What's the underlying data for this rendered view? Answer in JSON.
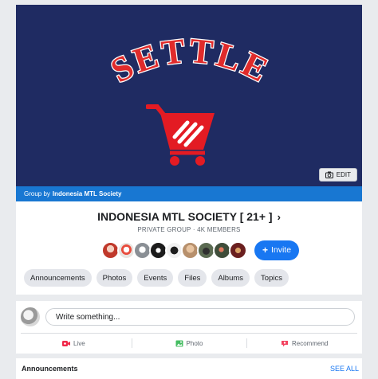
{
  "cover": {
    "title": "SETTLE",
    "edit_label": "EDIT",
    "colors": {
      "background": "#1f2b62",
      "title_fill": "#e02b2b",
      "cart": "#e31b23"
    }
  },
  "group_by": {
    "prefix": "Group by",
    "name": "Indonesia MTL Society"
  },
  "group": {
    "name": "INDONESIA MTL SOCIETY [ 21+ ]",
    "meta": "PRIVATE GROUP · 4K MEMBERS",
    "invite_label": "Invite"
  },
  "members": [
    {
      "icon": "member-avatar",
      "color": "#c0392b"
    },
    {
      "icon": "member-avatar",
      "color": "#e8e4e0"
    },
    {
      "icon": "member-avatar",
      "color": "#8a8f95"
    },
    {
      "icon": "member-avatar",
      "color": "#1c1c1c"
    },
    {
      "icon": "member-avatar",
      "color": "#f1f1f1"
    },
    {
      "icon": "member-avatar",
      "color": "#b7906c"
    },
    {
      "icon": "member-avatar",
      "color": "#5b6b52"
    },
    {
      "icon": "member-avatar",
      "color": "#3f4d3a"
    },
    {
      "icon": "member-avatar",
      "color": "#6a1f1f"
    }
  ],
  "tabs": [
    "Announcements",
    "Photos",
    "Events",
    "Files",
    "Albums",
    "Topics"
  ],
  "composer": {
    "placeholder": "Write something...",
    "actions": [
      {
        "label": "Live",
        "icon": "live-video-icon",
        "color": "#f02849"
      },
      {
        "label": "Photo",
        "icon": "photo-icon",
        "color": "#45bd62"
      },
      {
        "label": "Recommend",
        "icon": "recommend-icon",
        "color": "#f3425f"
      }
    ]
  },
  "announcements": {
    "title": "Announcements",
    "see_all": "SEE ALL"
  },
  "accent": "#1877f2"
}
